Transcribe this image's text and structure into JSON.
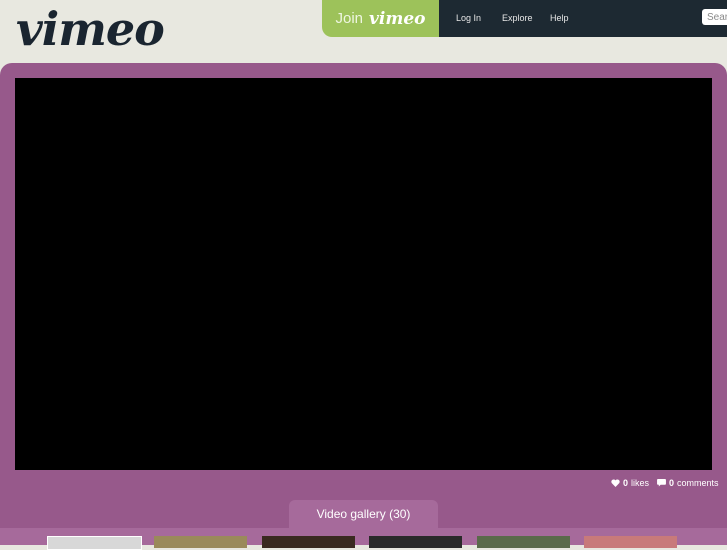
{
  "header": {
    "logo": "vimeo",
    "join": {
      "prefix": "Join",
      "brand": "vimeo"
    },
    "nav": [
      "Log In",
      "Explore",
      "Help"
    ],
    "search": {
      "placeholder": "Search Channels"
    }
  },
  "stats": {
    "likes_count": "0",
    "likes_label": "likes",
    "comments_count": "0",
    "comments_label": "comments"
  },
  "gallery": {
    "tab_label": "Video gallery (30)",
    "thumbnails": [
      {
        "name": "thumb-1",
        "color": "#d8d8d8"
      },
      {
        "name": "thumb-2",
        "color": "#9a8a5a"
      },
      {
        "name": "thumb-3",
        "color": "#3a2a20"
      },
      {
        "name": "thumb-4",
        "color": "#2a2a2a"
      },
      {
        "name": "thumb-5",
        "color": "#5a6a4a"
      },
      {
        "name": "thumb-6",
        "color": "#c87a7a"
      }
    ]
  },
  "colors": {
    "accent_green": "#9dc25a",
    "nav_dark": "#1d2932",
    "stage_purple": "#97598b"
  }
}
